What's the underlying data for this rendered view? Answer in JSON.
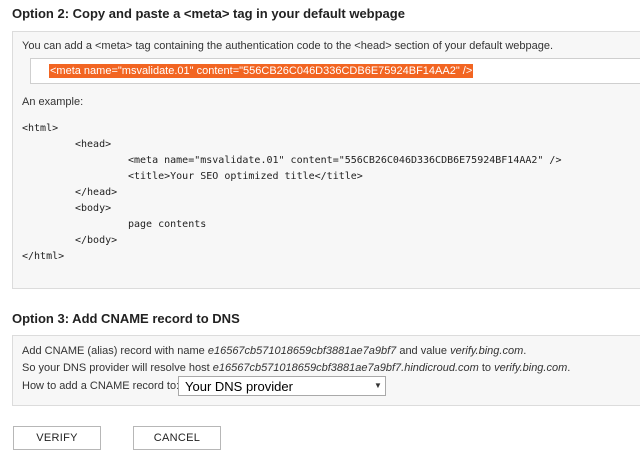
{
  "option2": {
    "heading": "Option 2: Copy and paste a <meta> tag in your default webpage",
    "intro": "You can add a <meta> tag containing the authentication code to the <head> section of your default webpage.",
    "meta_tag": "<meta name=\"msvalidate.01\" content=\"556CB26C046D336CDB6E75924BF14AA2\" />",
    "example_label": "An example:",
    "code_lines": [
      "<html>",
      "<head>",
      "<meta name=\"msvalidate.01\" content=\"556CB26C046D336CDB6E75924BF14AA2\" />",
      "<title>Your SEO optimized title</title>",
      "</head>",
      "<body>",
      "page contents",
      "</body>",
      "</html>"
    ]
  },
  "option3": {
    "heading": "Option 3: Add CNAME record to DNS",
    "line1_prefix": "Add CNAME (alias) record with name ",
    "cname_name": "e16567cb571018659cbf3881ae7a9bf7",
    "line1_mid": " and value ",
    "cname_value": "verify.bing.com",
    "line1_end": ".",
    "line2_prefix": "So your DNS provider will resolve host ",
    "resolve_host": "e16567cb571018659cbf3881ae7a9bf7.hindicroud.com",
    "line2_mid": " to ",
    "resolve_target": "verify.bing.com",
    "line2_end": ".",
    "how_to_label": "How to add a CNAME record to:",
    "dns_provider_selected": "Your DNS provider"
  },
  "buttons": {
    "verify": "VERIFY",
    "cancel": "CANCEL"
  },
  "colors": {
    "selection_highlight": "#f26522",
    "panel_background": "#f7f7f7"
  }
}
